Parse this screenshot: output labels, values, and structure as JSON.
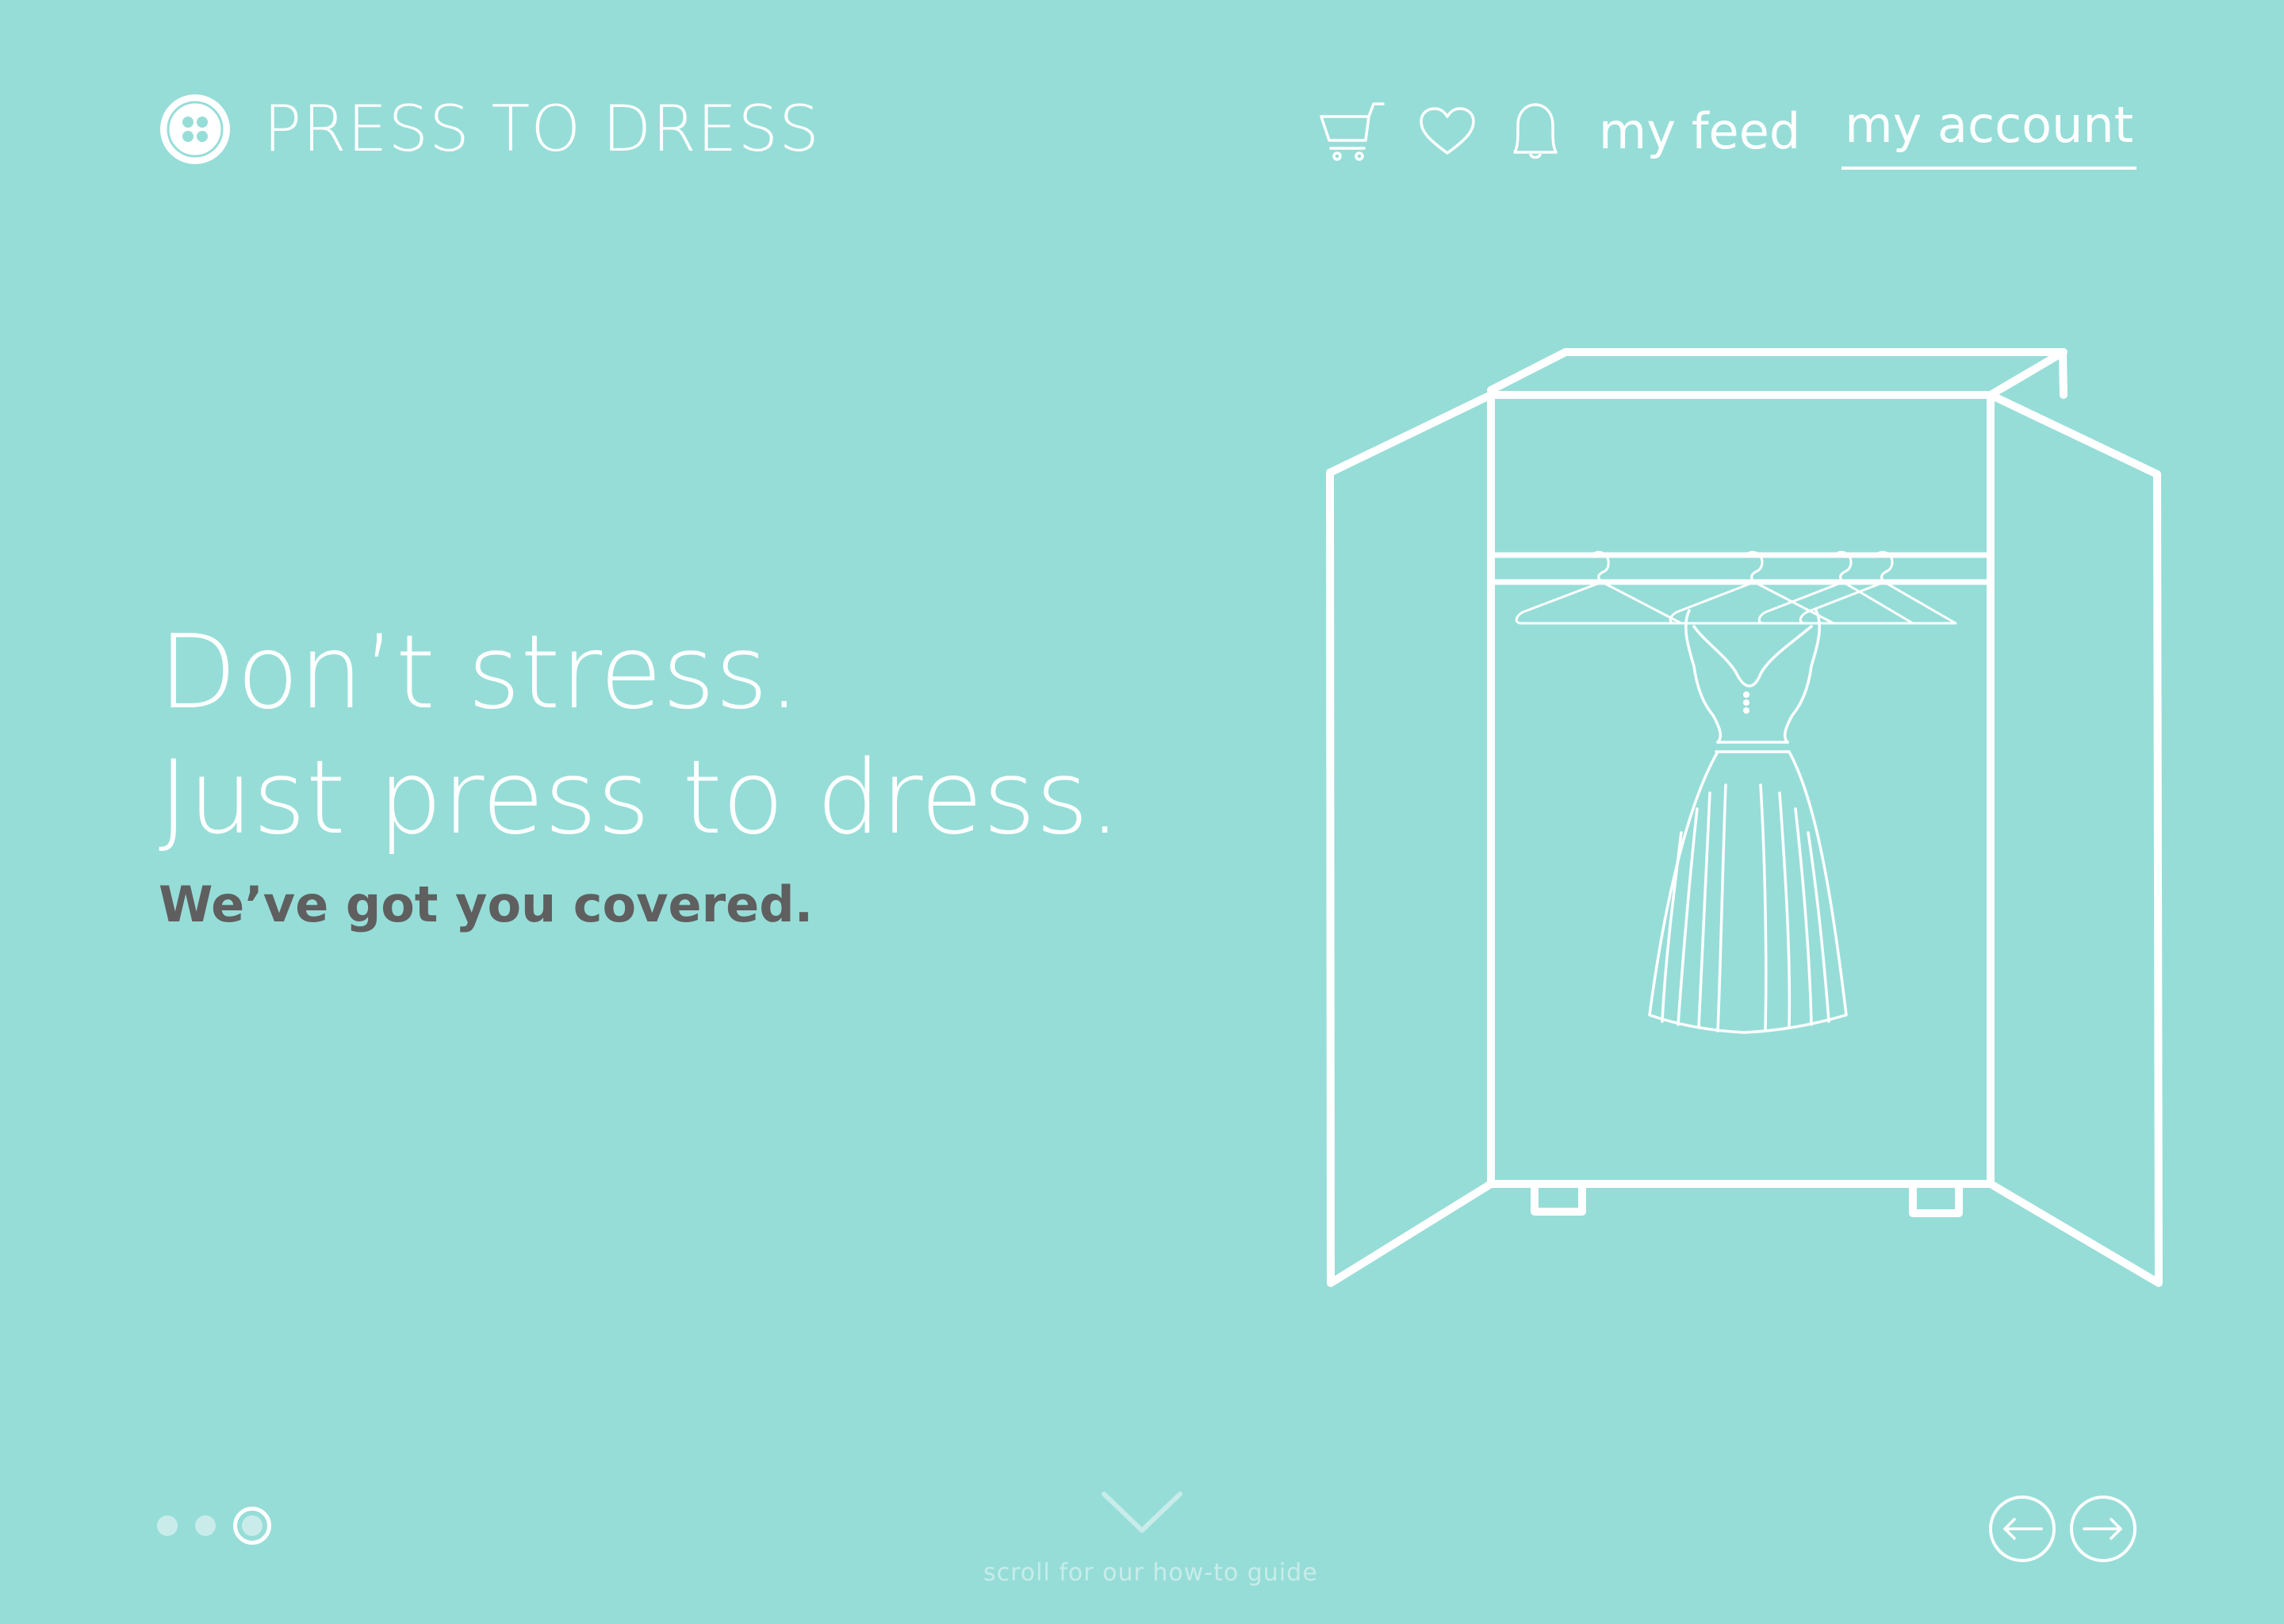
{
  "header": {
    "brand_name": "PRESS TO DRESS",
    "logo_icon": "button-icon",
    "nav": {
      "cart_icon": "cart-icon",
      "wishlist_icon": "heart-icon",
      "notifications_icon": "bell-icon",
      "feed_label": "my feed",
      "account_label": "my account"
    }
  },
  "hero": {
    "headline_line1": "Don’t stress.",
    "headline_line2": "Just press to dress.",
    "subheadline": "We’ve got you covered.",
    "illustration": "wardrobe-with-dress-illustration"
  },
  "footer": {
    "pagination": {
      "total": 3,
      "active": 3
    },
    "scroll_hint": "scroll for our how-to guide",
    "prev_icon": "arrow-left-icon",
    "next_icon": "arrow-right-icon"
  },
  "colors": {
    "background": "#96ddd8",
    "foreground": "#ffffff",
    "subheadline": "#5f5f5f",
    "muted": "#c8ecea"
  }
}
